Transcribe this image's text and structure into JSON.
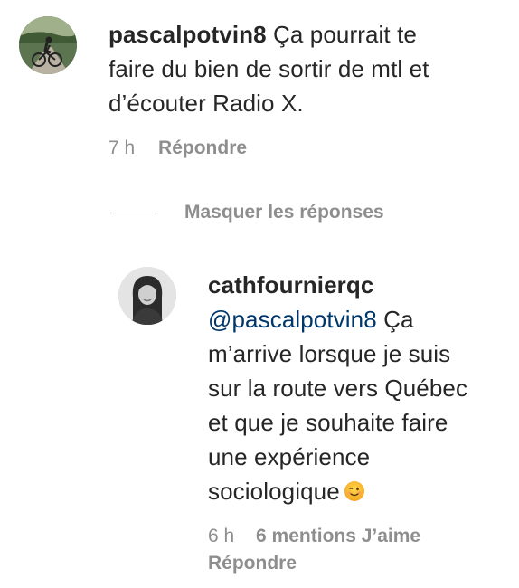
{
  "comments": [
    {
      "username": "pascalpotvin8",
      "text_lines": [
        "Ça pourrait te",
        "faire du bien de sortir de mtl et",
        "d’écouter Radio X."
      ],
      "time": "7 h",
      "reply_label": "Répondre"
    }
  ],
  "replies_toggle": {
    "label": "Masquer les réponses"
  },
  "reply": {
    "username": "cathfournierqc",
    "mention": "@pascalpotvin8",
    "text_first": "Ça",
    "text_lines": [
      "m’arrive lorsque je suis",
      "sur la route vers Québec",
      "et que je souhaite faire",
      "une expérience",
      "sociologique"
    ],
    "emoji": "winking-face-emoji",
    "time": "6 h",
    "likes": "6 mentions J’aime",
    "reply_label": "Répondre"
  },
  "colors": {
    "text": "#262626",
    "secondary": "#8e8e8e",
    "mention": "#00376b"
  }
}
